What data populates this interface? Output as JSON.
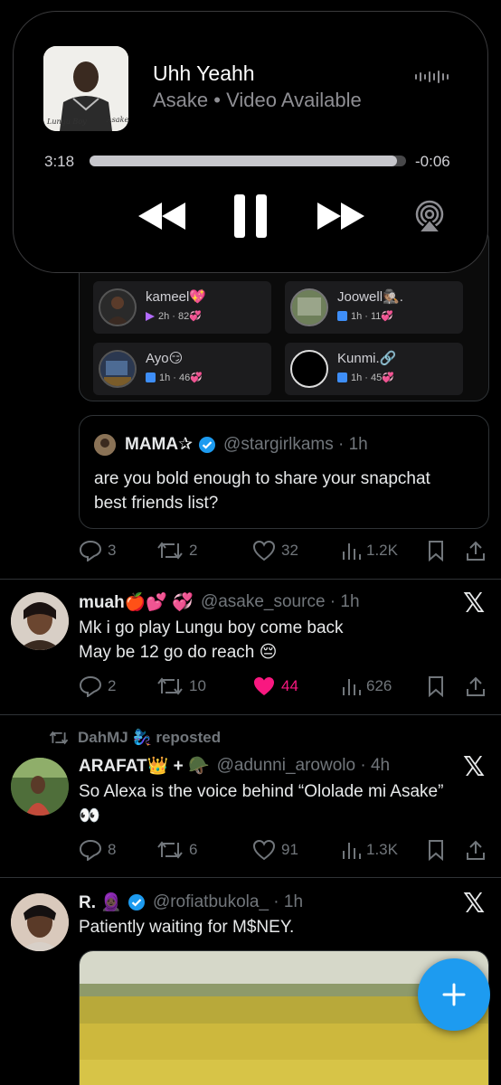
{
  "now_playing": {
    "title": "Uhh Yeahh",
    "subtitle": "Asake • Video Available",
    "elapsed": "3:18",
    "remaining": "-0:06",
    "progress": 0.97,
    "album_text_left": "Lungu Boy",
    "album_text_right": "Asake"
  },
  "snap_embed": {
    "friends": [
      {
        "name": "kameel💖",
        "meta": "2h · 82💞"
      },
      {
        "name": "Joowell🕵🏽.",
        "meta": "1h · 11💞"
      },
      {
        "name": "Ayo😏",
        "meta": "1h · 46💞"
      },
      {
        "name": "Kunmi.🔗",
        "meta": "1h · 45💞"
      }
    ]
  },
  "quote": {
    "name": "MAMA✰",
    "handle": "@stargirlkams · 1h",
    "text_line1": "are you bold enough to share your snapchat",
    "text_line2": "best friends list?"
  },
  "quote_actions": {
    "replies": "3",
    "reposts": "2",
    "likes": "32",
    "views": "1.2K"
  },
  "tweets": [
    {
      "name": "muah🍎💕 💞",
      "handle": "@asake_source · 1h",
      "line1": "Mk i go play Lungu boy come back",
      "line2": "May be 12 go do reach 😔",
      "replies": "2",
      "reposts": "10",
      "likes": "44",
      "views": "626"
    },
    {
      "repost_by": "DahMJ 🧞‍♀️ reposted",
      "name": "ARAFAT👑 + 🪖",
      "handle": "@adunni_arowolo · 4h",
      "line1": "So Alexa is the voice behind “Ololade mi Asake”",
      "line2": "👀",
      "replies": "8",
      "reposts": "6",
      "likes": "91",
      "views": "1.3K"
    },
    {
      "name": "R. 🧕🏿",
      "handle": "@rofiatbukola_ · 1h",
      "line1": "Patiently waiting for M$NEY."
    }
  ],
  "colors": {
    "accent": "#1d9bf0",
    "like": "#f91880",
    "muted": "#71767b"
  }
}
